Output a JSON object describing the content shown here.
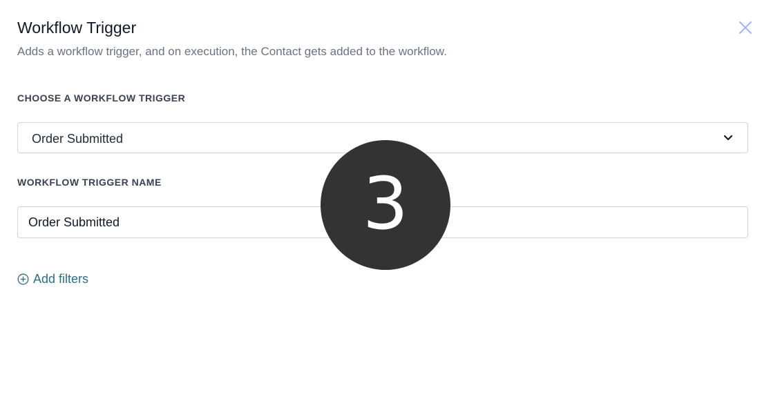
{
  "header": {
    "title": "Workflow Trigger",
    "subtitle": "Adds a workflow trigger, and on execution, the Contact gets added to the workflow.",
    "close_icon": "close-icon"
  },
  "trigger_select": {
    "label": "CHOOSE A WORKFLOW TRIGGER",
    "selected": "Order Submitted",
    "icon": "chevron-down-icon"
  },
  "trigger_name": {
    "label": "WORKFLOW TRIGGER NAME",
    "value": "Order Submitted"
  },
  "filters": {
    "add_label": "Add filters",
    "icon": "plus-circle-icon"
  },
  "step_badge": {
    "number": "3"
  },
  "colors": {
    "link": "#2b6f86",
    "close": "#a5b4fc",
    "badge": "#333333"
  }
}
